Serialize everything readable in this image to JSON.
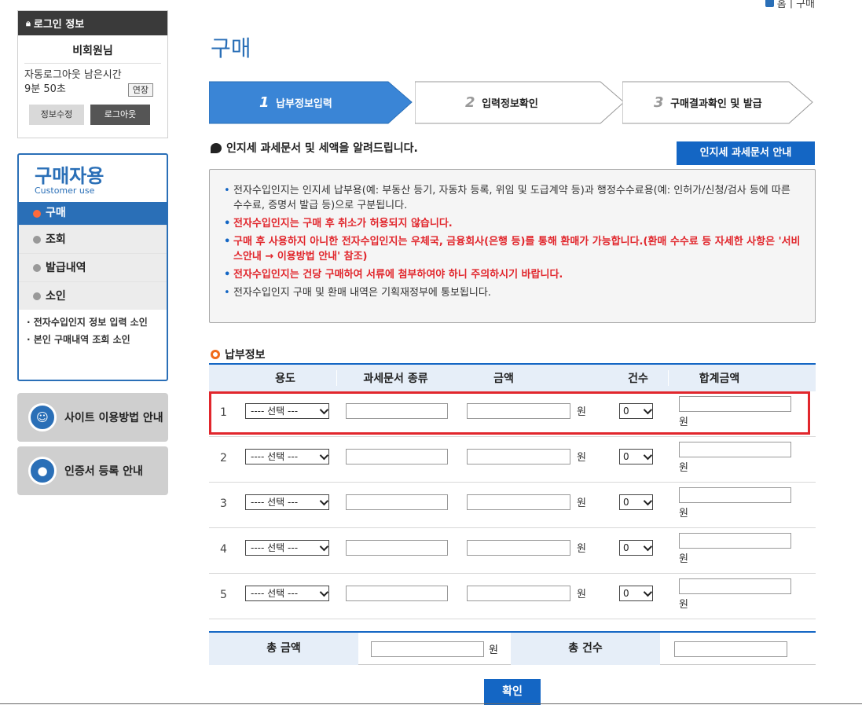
{
  "breadcrumb": {
    "home": "홈",
    "sep": "|",
    "current": "구매"
  },
  "login": {
    "header": "로그인 정보",
    "user": "비회원님",
    "auto_logout_label": "자동로그아웃 남은시간",
    "remaining": "9분 50초",
    "extend": "연장",
    "edit_info": "정보수정",
    "logout": "로그아웃"
  },
  "menu": {
    "title": "구매자용",
    "subtitle": "Customer use",
    "items": [
      {
        "label": "구매"
      },
      {
        "label": "조회"
      },
      {
        "label": "발급내역"
      },
      {
        "label": "소인"
      }
    ],
    "sub_links": [
      "· 전자수입인지 정보 입력 소인",
      "· 본인 구매내역 조회 소인"
    ]
  },
  "guides": {
    "site_usage": "사이트 이용방법 안내",
    "cert_register": "인증서 등록 안내"
  },
  "page_title": "구매",
  "steps": [
    {
      "num": "1",
      "label": "납부정보입력"
    },
    {
      "num": "2",
      "label": "입력정보확인"
    },
    {
      "num": "3",
      "label": "구매결과확인 및 발급"
    }
  ],
  "notice": {
    "heading": "인지세 과세문서 및 세액을 알려드립니다.",
    "guide_button": "인지세 과세문서 안내",
    "items": [
      {
        "text": "전자수입인지는 인지세 납부용(예: 부동산 등기, 자동차 등록, 위임 및 도급계약 등)과 행정수수료용(예: 인허가/신청/검사 등에 따른 수수료, 증명서 발급 등)으로 구분됩니다.",
        "red": false
      },
      {
        "text": "전자수입인지는 구매 후 취소가 허용되지 않습니다.",
        "red": true
      },
      {
        "text": "구매 후 사용하지 아니한 전자수입인지는 우체국, 금융회사(은행 등)를 통해 환매가 가능합니다.(환매 수수료 등 자세한 사항은 '서비스안내 → 이용방법 안내' 참조)",
        "red": true
      },
      {
        "text": "전자수입인지는 건당 구매하여 서류에 첨부하여야 하니 주의하시기 바랍니다.",
        "red": true
      },
      {
        "text": "전자수입인지 구매 및 환매 내역은 기획재정부에 통보됩니다.",
        "red": false
      }
    ]
  },
  "payment": {
    "section_title": "납부정보",
    "columns": [
      "용도",
      "과세문서 종류",
      "금액",
      "건수",
      "합계금액"
    ],
    "purpose_placeholder": "---- 선택 ---",
    "won": "원",
    "rows": [
      {
        "num": "1",
        "count": "0"
      },
      {
        "num": "2",
        "count": "0"
      },
      {
        "num": "3",
        "count": "0"
      },
      {
        "num": "4",
        "count": "0"
      },
      {
        "num": "5",
        "count": "0"
      }
    ]
  },
  "totals": {
    "total_amount_label": "총 금액",
    "won": "원",
    "total_count_label": "총 건수"
  },
  "confirm": "확인"
}
